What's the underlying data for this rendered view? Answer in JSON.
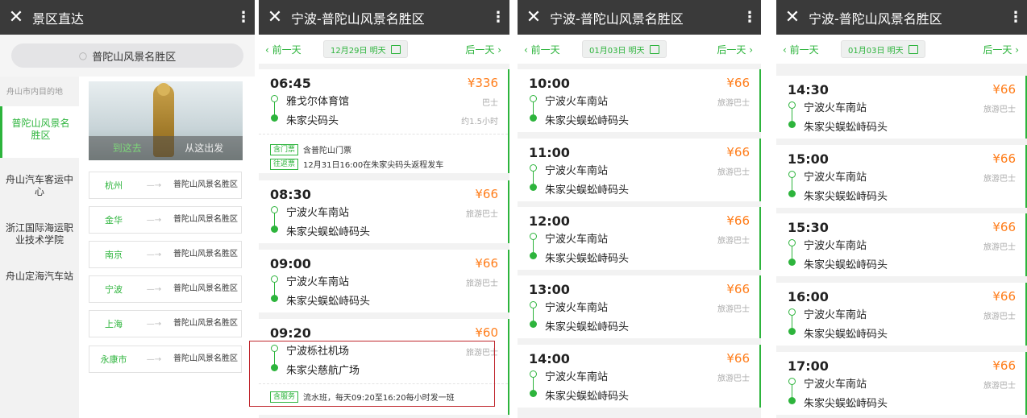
{
  "panel1": {
    "header": {
      "close": "✕",
      "title": "景区直达",
      "more": "⋮"
    },
    "search": {
      "icon": "search-icon",
      "text": "普陀山风景名胜区"
    },
    "sidebar": [
      {
        "label": "舟山市内目的地"
      },
      {
        "label": "普陀山风景名胜区"
      },
      {
        "label": "舟山汽车客运中心"
      },
      {
        "label": "浙江国际海运职业技术学院"
      },
      {
        "label": "舟山定海汽车站"
      }
    ],
    "hero": {
      "go": "到这去",
      "from": "从这出发"
    },
    "routes": [
      {
        "from": "杭州",
        "to": "普陀山风景名胜区"
      },
      {
        "from": "金华",
        "to": "普陀山风景名胜区"
      },
      {
        "from": "南京",
        "to": "普陀山风景名胜区"
      },
      {
        "from": "宁波",
        "to": "普陀山风景名胜区"
      },
      {
        "from": "上海",
        "to": "普陀山风景名胜区"
      },
      {
        "from": "永康市",
        "to": "普陀山风景名胜区"
      }
    ]
  },
  "panel2": {
    "header": {
      "close": "✕",
      "title": "宁波-普陀山风景名胜区",
      "more": "⋮"
    },
    "datebar": {
      "prev": "‹ 前一天",
      "date": "12月29日 明天",
      "next": "后一天 ›"
    },
    "trips": [
      {
        "time": "06:45",
        "price": "¥336",
        "type": "巴士",
        "duration": "约1.5小时",
        "from": "雅戈尔体育馆",
        "to": "朱家尖码头",
        "extras": [
          {
            "tag": "含门票",
            "text": "含普陀山门票"
          },
          {
            "tag": "往返票",
            "text": "12月31日16:00在朱家尖码头返程发车"
          }
        ]
      },
      {
        "time": "08:30",
        "price": "¥66",
        "type": "旅游巴士",
        "from": "宁波火车南站",
        "to": "朱家尖蜈蚣峙码头"
      },
      {
        "time": "09:00",
        "price": "¥66",
        "type": "旅游巴士",
        "from": "宁波火车南站",
        "to": "朱家尖蜈蚣峙码头"
      },
      {
        "time": "09:20",
        "price": "¥60",
        "type": "旅游巴士",
        "from": "宁波栎社机场",
        "to": "朱家尖慈航广场",
        "extras": [
          {
            "tag": "含服务",
            "text": "流水班，每天09:20至16:20每小时发一班"
          }
        ]
      }
    ]
  },
  "panel3": {
    "header": {
      "close": "✕",
      "title": "宁波-普陀山风景名胜区",
      "more": "⋮"
    },
    "datebar": {
      "prev": "‹ 前一天",
      "date": "01月03日 明天",
      "next": "后一天 ›"
    },
    "trips": [
      {
        "time": "10:00",
        "price": "¥66",
        "type": "旅游巴士",
        "from": "宁波火车南站",
        "to": "朱家尖蜈蚣峙码头"
      },
      {
        "time": "11:00",
        "price": "¥66",
        "type": "旅游巴士",
        "from": "宁波火车南站",
        "to": "朱家尖蜈蚣峙码头"
      },
      {
        "time": "12:00",
        "price": "¥66",
        "type": "旅游巴士",
        "from": "宁波火车南站",
        "to": "朱家尖蜈蚣峙码头"
      },
      {
        "time": "13:00",
        "price": "¥66",
        "type": "旅游巴士",
        "from": "宁波火车南站",
        "to": "朱家尖蜈蚣峙码头"
      },
      {
        "time": "14:00",
        "price": "¥66",
        "type": "旅游巴士",
        "from": "宁波火车南站",
        "to": "朱家尖蜈蚣峙码头"
      }
    ]
  },
  "panel4": {
    "header": {
      "close": "✕",
      "title": "宁波-普陀山风景名胜区",
      "more": "⋮"
    },
    "datebar": {
      "prev": "‹ 前一天",
      "date": "01月03日 明天",
      "next": "后一天 ›"
    },
    "trips": [
      {
        "time": "14:30",
        "price": "¥66",
        "type": "旅游巴士",
        "from": "宁波火车南站",
        "to": "朱家尖蜈蚣峙码头"
      },
      {
        "time": "15:00",
        "price": "¥66",
        "type": "旅游巴士",
        "from": "宁波火车南站",
        "to": "朱家尖蜈蚣峙码头"
      },
      {
        "time": "15:30",
        "price": "¥66",
        "type": "旅游巴士",
        "from": "宁波火车南站",
        "to": "朱家尖蜈蚣峙码头"
      },
      {
        "time": "16:00",
        "price": "¥66",
        "type": "旅游巴士",
        "from": "宁波火车南站",
        "to": "朱家尖蜈蚣峙码头"
      },
      {
        "time": "17:00",
        "price": "¥66",
        "type": "旅游巴士",
        "from": "宁波火车南站",
        "to": "朱家尖蜈蚣峙码头"
      }
    ]
  },
  "colors": {
    "accent": "#2db43c",
    "price": "#ff7d1a",
    "header": "#3a3a3a",
    "highlight": "#c0262d"
  }
}
